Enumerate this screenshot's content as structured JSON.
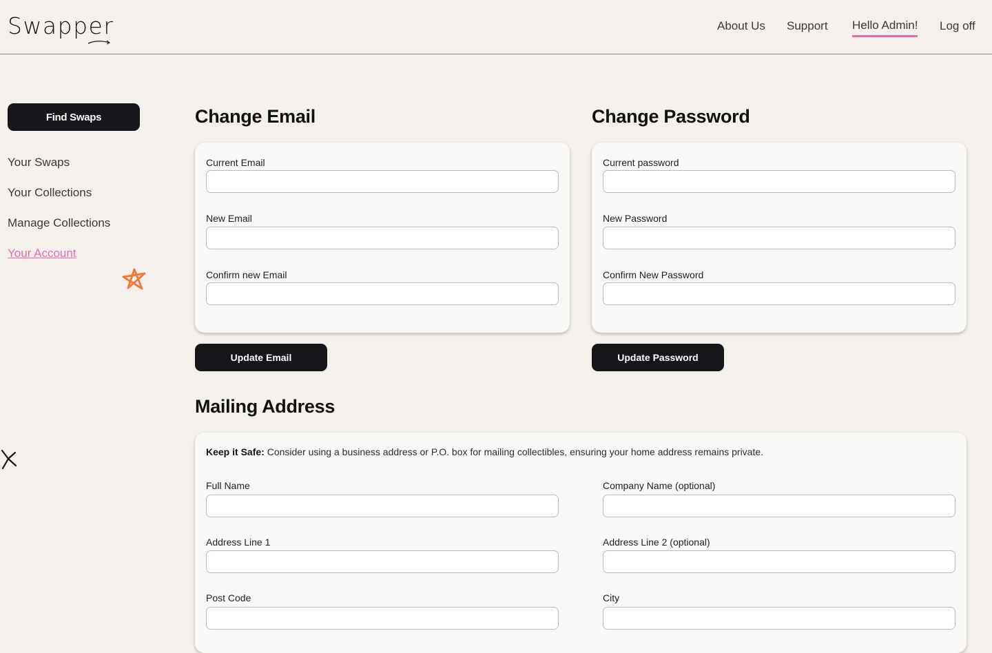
{
  "header": {
    "logo": "Swapper",
    "nav": [
      {
        "label": "About Us"
      },
      {
        "label": "Support"
      },
      {
        "label": "Hello Admin!"
      },
      {
        "label": "Log off"
      }
    ],
    "accent_color": "#e96aa8"
  },
  "sidebar": {
    "find_button": "Find Swaps",
    "items": [
      {
        "label": "Your Swaps"
      },
      {
        "label": "Your Collections"
      },
      {
        "label": "Manage Collections"
      },
      {
        "label": "Your Account"
      }
    ],
    "decor_icons": [
      "star-doodle-icon",
      "sparkle-icon"
    ],
    "star_color": "#f07a3c"
  },
  "change_email": {
    "title": "Change Email",
    "fields": [
      {
        "label": "Current Email",
        "value": ""
      },
      {
        "label": "New Email",
        "value": ""
      },
      {
        "label": "Confirm new Email",
        "value": ""
      }
    ],
    "button": "Update Email"
  },
  "change_password": {
    "title": "Change Password",
    "fields": [
      {
        "label": "Current password",
        "value": ""
      },
      {
        "label": "New Password",
        "value": ""
      },
      {
        "label": "Confirm New Password",
        "value": ""
      }
    ],
    "button": "Update Password"
  },
  "mailing": {
    "title": "Mailing Address",
    "notice_bold": "Keep it Safe:",
    "notice_text": " Consider using a business address or P.O. box for mailing collectibles, ensuring your home address remains private.",
    "fields": [
      {
        "label": "Full Name",
        "value": ""
      },
      {
        "label": "Company Name (optional)",
        "value": ""
      },
      {
        "label": "Address Line 1",
        "value": ""
      },
      {
        "label": "Address Line 2 (optional)",
        "value": ""
      },
      {
        "label": "Post Code",
        "value": ""
      },
      {
        "label": "City",
        "value": ""
      }
    ]
  }
}
